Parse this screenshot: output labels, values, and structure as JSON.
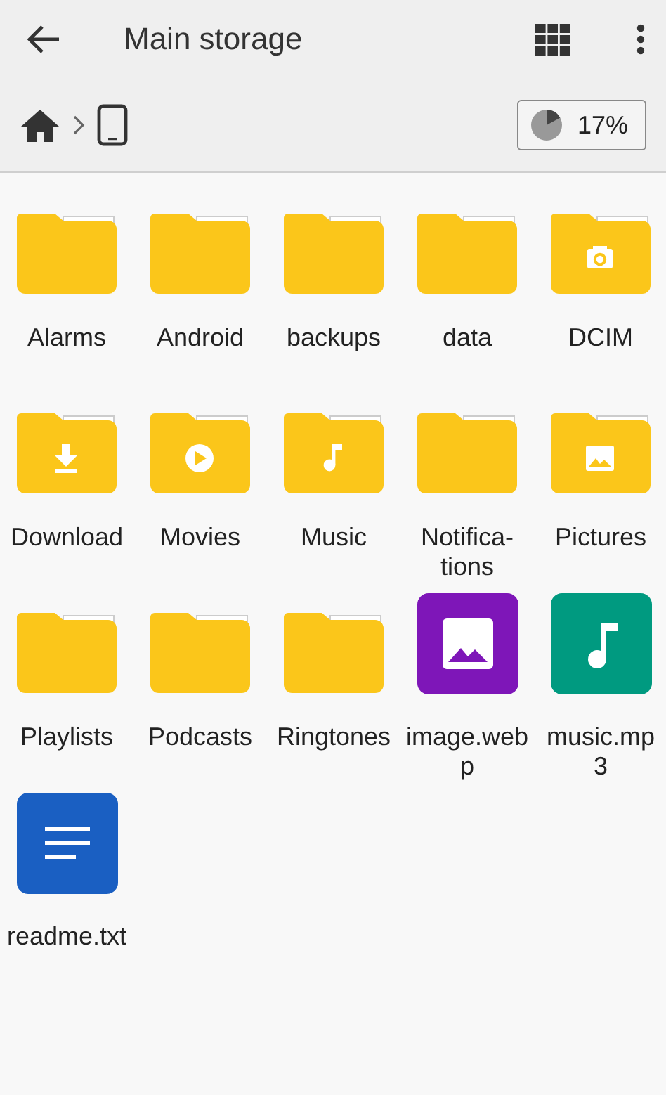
{
  "toolbar": {
    "title": "Main storage"
  },
  "storage": {
    "level": 0.17,
    "reading": "17%"
  },
  "items": [
    {
      "kind": "folder",
      "label": [
        "Alarms"
      ]
    },
    {
      "kind": "folder",
      "label": [
        "Android"
      ]
    },
    {
      "kind": "folder",
      "label": [
        "backups"
      ]
    },
    {
      "kind": "folder",
      "label": [
        "data"
      ]
    },
    {
      "kind": "camera",
      "label": [
        "DCIM"
      ]
    },
    {
      "kind": "download",
      "label": [
        "Download"
      ]
    },
    {
      "kind": "movies",
      "label": [
        "Movies"
      ]
    },
    {
      "kind": "music",
      "label": [
        "Music"
      ]
    },
    {
      "kind": "folder",
      "label": [
        "Notifica-",
        "tions"
      ]
    },
    {
      "kind": "pictures",
      "label": [
        "Pictures"
      ]
    },
    {
      "kind": "folder",
      "label": [
        "Playlists"
      ]
    },
    {
      "kind": "folder",
      "label": [
        "Podcasts"
      ]
    },
    {
      "kind": "folder",
      "label": [
        "Ringtones"
      ]
    },
    {
      "kind": "image",
      "label": [
        "image.web",
        "p"
      ]
    },
    {
      "kind": "audio",
      "label": [
        "music.mp",
        "3"
      ]
    },
    {
      "kind": "text",
      "label": [
        "readme.txt"
      ]
    }
  ]
}
